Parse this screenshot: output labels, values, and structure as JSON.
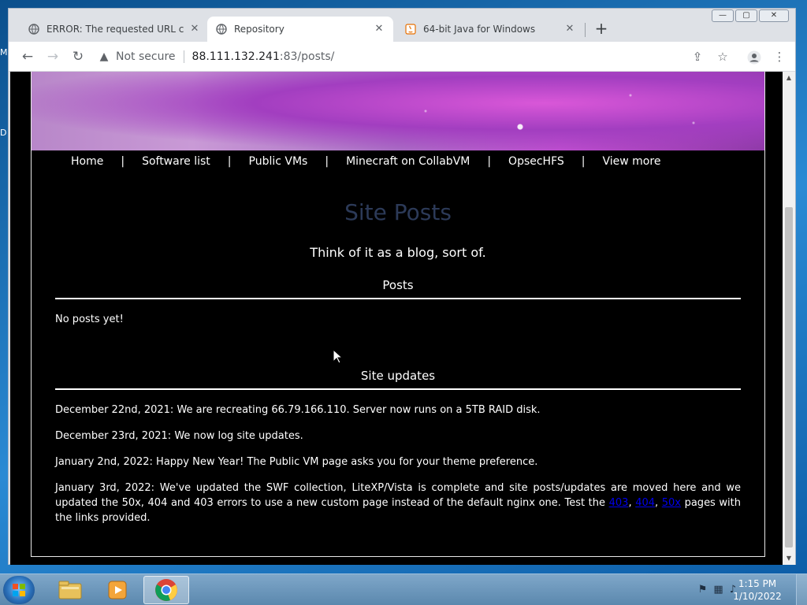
{
  "desktop": {
    "edge_labels": [
      "M",
      "D"
    ]
  },
  "window_controls": {
    "minimize": "—",
    "restore": "▢",
    "close": "✕"
  },
  "tabs": [
    {
      "title": "ERROR: The requested URL could",
      "icon": "globe-icon"
    },
    {
      "title": "Repository",
      "icon": "globe-icon"
    },
    {
      "title": "64-bit Java for Windows",
      "icon": "java-icon"
    }
  ],
  "toolbar": {
    "back": "←",
    "forward": "→",
    "reload": "↻",
    "security_label": "Not secure",
    "url_host": "88.111.132.241",
    "url_path": ":83/posts/"
  },
  "site": {
    "nav": [
      "Home",
      "Software list",
      "Public VMs",
      "Minecraft on CollabVM",
      "OpsecHFS",
      "View more"
    ],
    "nav_separator": "|",
    "heading": "Site Posts",
    "tagline": "Think of it as a blog, sort of.",
    "posts_title": "Posts",
    "posts_empty": "No posts yet!",
    "updates_title": "Site updates",
    "updates": [
      "December 22nd, 2021: We are recreating 66.79.166.110. Server now runs on a 5TB RAID disk.",
      "December 23rd, 2021: We now log site updates.",
      "January 2nd, 2022: Happy New Year! The Public VM page asks you for your theme preference."
    ],
    "last_update": {
      "text_before": "January 3rd, 2022: We've updated the SWF collection, LiteXP/Vista is complete and site posts/updates are moved here and we updated the 50x, 404 and 403 errors to use a new custom page instead of the default nginx one. Test the ",
      "links": [
        "403",
        "404",
        "50x"
      ],
      "link_sep": ", ",
      "text_after": " pages with the links provided."
    }
  },
  "taskbar": {
    "apps": [
      "explorer-icon",
      "media-player-icon",
      "chrome-icon"
    ],
    "clock_time": "1:15 PM",
    "clock_date": "1/10/2022"
  }
}
